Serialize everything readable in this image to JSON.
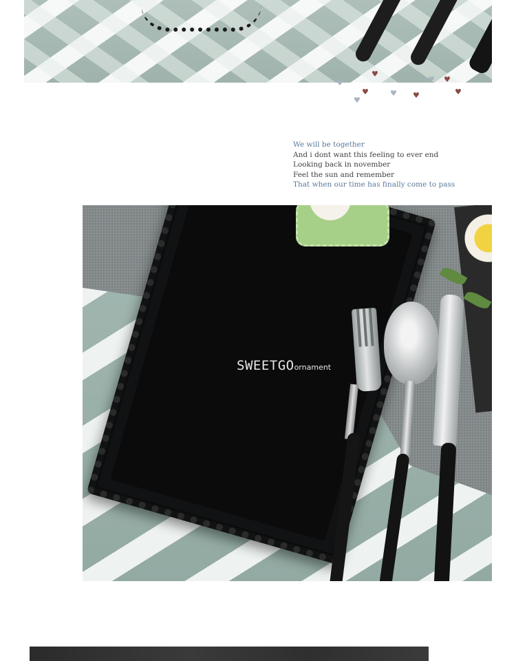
{
  "lyrics": [
    {
      "text": "We will be together",
      "highlight": true
    },
    {
      "text": "And i dont want this feeling to ever end",
      "highlight": false
    },
    {
      "text": "Looking back in november",
      "highlight": false
    },
    {
      "text": "Feel the sun and remember",
      "highlight": false
    },
    {
      "text": "That when our time has finally come to pass",
      "highlight": true
    }
  ],
  "watermark": {
    "brand": "SWEETGO",
    "suffix": "ornament"
  },
  "images": {
    "top": "tablecloth-with-lace-tray-and-black-cutlery",
    "main": "black-lace-tray-with-fork-spoon-knife-on-chevron-tablecloth",
    "bottom": "dark-product-photo-strip"
  },
  "colors": {
    "lyric_text": "#3f3f3f",
    "lyric_highlight": "#5a7a9a",
    "heart_dark": "#8a4a44",
    "heart_light": "#a8b4c0"
  }
}
